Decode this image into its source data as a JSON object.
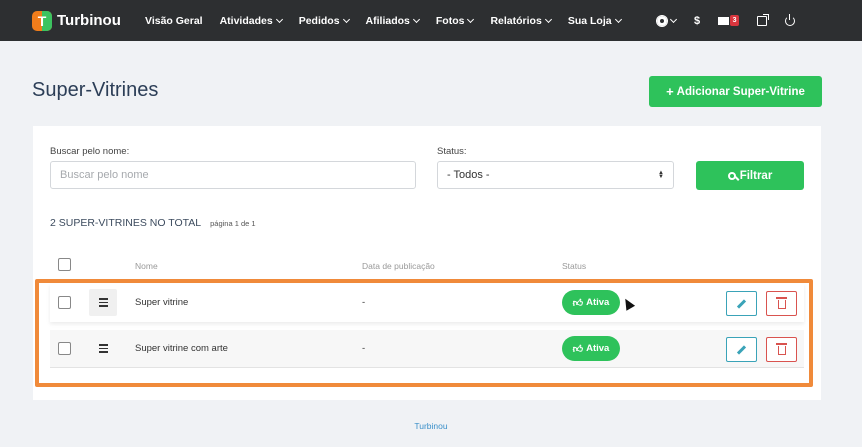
{
  "brand": {
    "name": "Turbinou",
    "logo_letter": "T"
  },
  "nav": {
    "items": [
      {
        "label": "Visão Geral",
        "dropdown": false
      },
      {
        "label": "Atividades",
        "dropdown": true
      },
      {
        "label": "Pedidos",
        "dropdown": true
      },
      {
        "label": "Afiliados",
        "dropdown": true
      },
      {
        "label": "Fotos",
        "dropdown": true
      },
      {
        "label": "Relatórios",
        "dropdown": true
      },
      {
        "label": "Sua Loja",
        "dropdown": true
      }
    ],
    "icons": {
      "settings": "gear-icon",
      "money_label": "$",
      "messages": "envelope-icon",
      "messages_badge": "3",
      "external": "external-link-icon",
      "logout": "power-icon"
    }
  },
  "page": {
    "title": "Super-Vitrines",
    "add_button_label": "Adicionar Super-Vitrine"
  },
  "filters": {
    "search_label": "Buscar pelo nome:",
    "search_placeholder": "Buscar pelo nome",
    "search_value": "",
    "status_label": "Status:",
    "status_value": "- Todos -",
    "filter_button_label": "Filtrar"
  },
  "summary": {
    "total_text": "2 SUPER-VITRINES NO TOTAL",
    "page_text": "página 1 de 1"
  },
  "table": {
    "headers": {
      "name": "Nome",
      "date": "Data de publicação",
      "status": "Status"
    },
    "rows": [
      {
        "name": "Super vitrine",
        "date": "-",
        "status": "Ativa"
      },
      {
        "name": "Super vitrine com arte",
        "date": "-",
        "status": "Ativa"
      }
    ]
  },
  "footer": {
    "text": "Turbinou"
  },
  "colors": {
    "navbar": "#2d2f31",
    "accent_green": "#2ec25b",
    "highlight_orange": "#f08a3a",
    "edit_teal": "#3aa3b8",
    "delete_red": "#d9534f"
  }
}
